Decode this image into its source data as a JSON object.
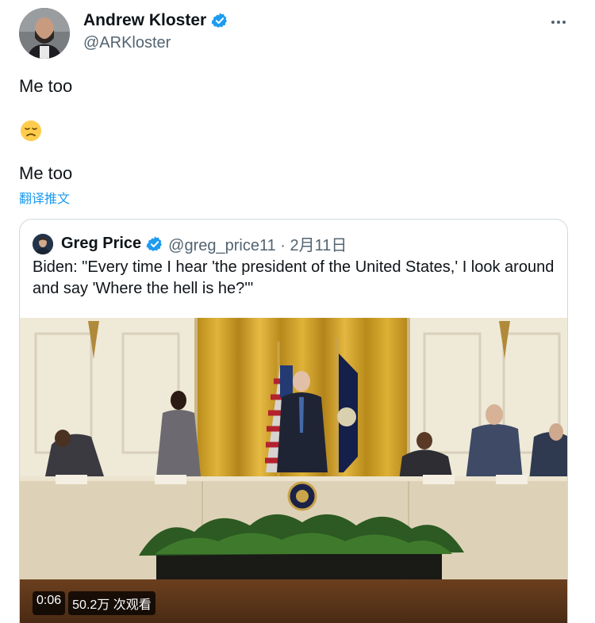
{
  "author": {
    "display_name": "Andrew Kloster",
    "handle": "@ARKloster",
    "verified_icon": "verified-badge-icon"
  },
  "tweet": {
    "line_1": "Me too",
    "emoji": "disappointed-face",
    "line_2": "Me too",
    "translate_label": "翻译推文"
  },
  "quote": {
    "display_name": "Greg Price",
    "handle_and_date": "@greg_price11 · 2月11日",
    "text": "Biden: \"Every time I hear 'the president of the United States,' I look around and say 'Where the hell is he?'\"",
    "video": {
      "duration": "0:06",
      "views": "50.2万 次观看"
    }
  },
  "colors": {
    "accent": "#1d9bf0",
    "text_primary": "#0f1419",
    "text_secondary": "#536471",
    "border": "#cfd9de"
  }
}
